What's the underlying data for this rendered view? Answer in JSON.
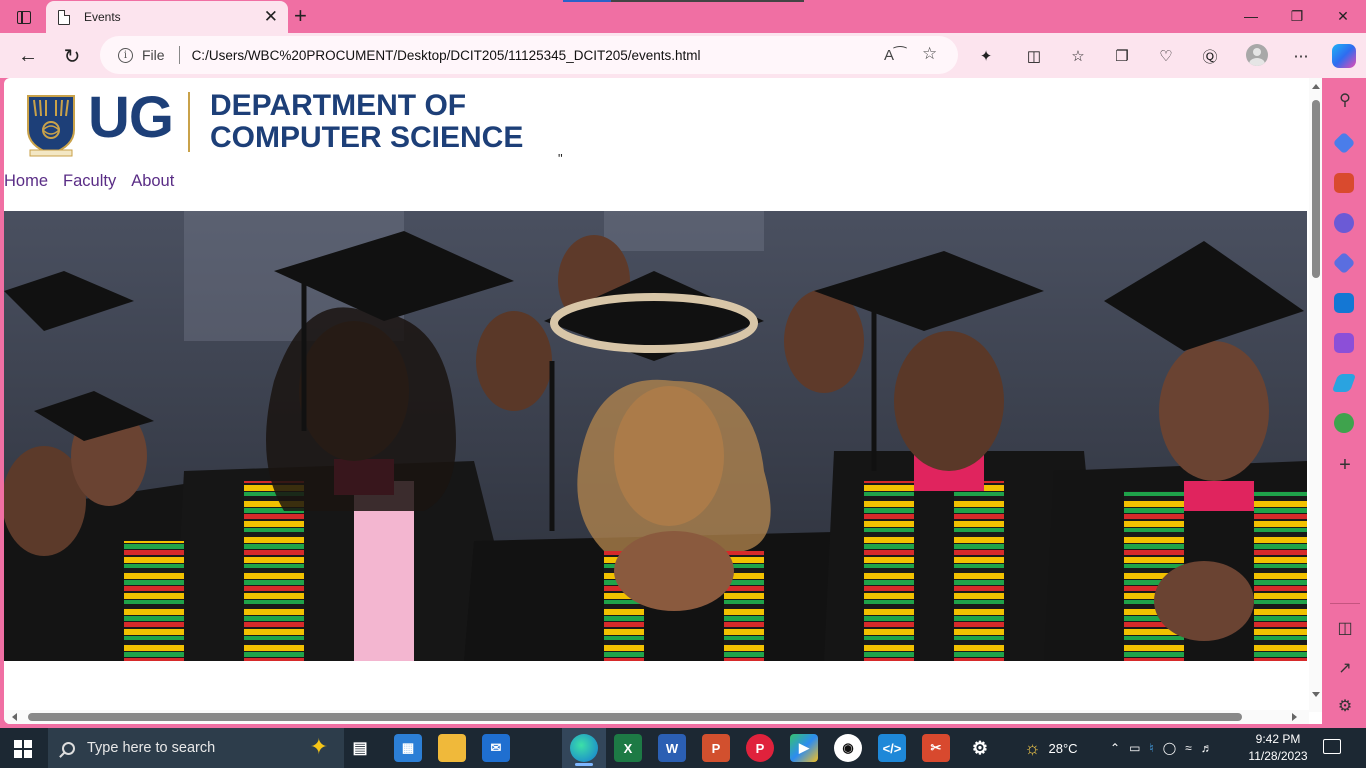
{
  "browser": {
    "tab": {
      "title": "Events"
    },
    "address": {
      "scheme_label": "File",
      "url": "C:/Users/WBC%20PROCUMENT/Desktop/DCIT205/11125345_DCIT205/events.html"
    }
  },
  "page": {
    "logo": {
      "short": "UG",
      "dept_line1": "DEPARTMENT OF",
      "dept_line2": "COMPUTER SCIENCE"
    },
    "stray_text": "\"",
    "nav": [
      {
        "label": "Home"
      },
      {
        "label": "Faculty"
      },
      {
        "label": "About"
      }
    ],
    "hero": {
      "subject": "graduates in caps, gowns and kente stoles"
    }
  },
  "taskbar": {
    "search_placeholder": "Type here to search",
    "weather": "28°C",
    "time": "9:42 PM",
    "date": "11/28/2023"
  },
  "colors": {
    "frame": "#f06fa3",
    "toolbar": "#fce4ee",
    "brand_blue": "#1d3f78",
    "nav_link": "#5a2d86",
    "taskbar": "#1c2833"
  }
}
